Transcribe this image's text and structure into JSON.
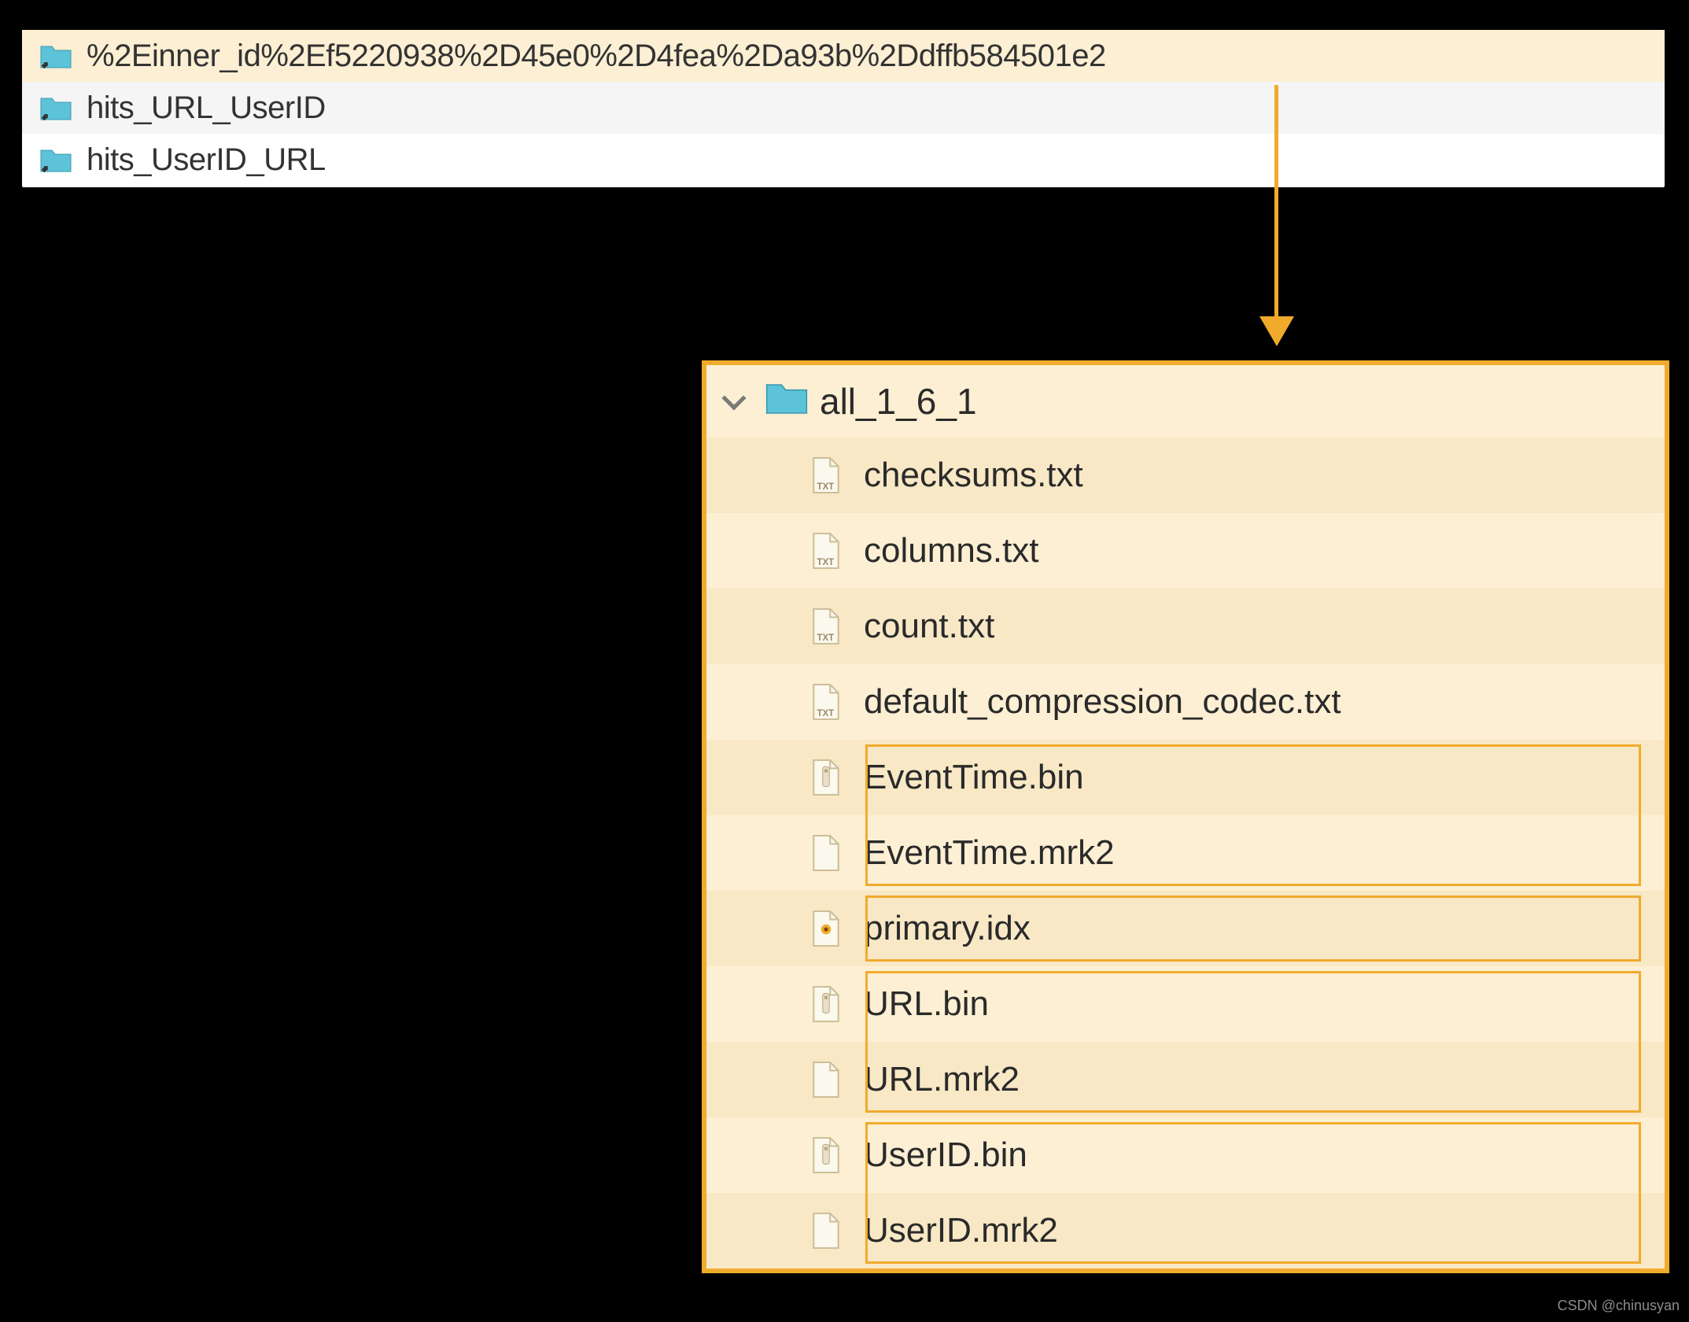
{
  "colors": {
    "accent": "#f1ab2c",
    "highlight_bg": "#fcefd3",
    "folder_fill": "#5cc3d9",
    "txt_label": "#9b8a6a",
    "bin_accent": "#f1ab2c"
  },
  "top_panel": {
    "rows": [
      {
        "icon": "folder-shortcut-icon",
        "label": "%2Einner_id%2Ef5220938%2D45e0%2D4fea%2Da93b%2Ddffb584501e2",
        "selected": true
      },
      {
        "icon": "folder-shortcut-icon",
        "label": "hits_URL_UserID",
        "selected": false
      },
      {
        "icon": "folder-shortcut-icon",
        "label": "hits_UserID_URL",
        "selected": false
      }
    ]
  },
  "bottom_panel": {
    "header": {
      "icon": "folder-icon",
      "label": "all_1_6_1",
      "expanded": true
    },
    "rows": [
      {
        "icon": "txt-file-icon",
        "label": "checksums.txt"
      },
      {
        "icon": "txt-file-icon",
        "label": "columns.txt"
      },
      {
        "icon": "txt-file-icon",
        "label": "count.txt"
      },
      {
        "icon": "txt-file-icon",
        "label": "default_compression_codec.txt"
      },
      {
        "icon": "bin-file-icon",
        "label": "EventTime.bin"
      },
      {
        "icon": "file-icon",
        "label": "EventTime.mrk2"
      },
      {
        "icon": "idx-file-icon",
        "label": "primary.idx"
      },
      {
        "icon": "bin-file-icon",
        "label": "URL.bin"
      },
      {
        "icon": "file-icon",
        "label": "URL.mrk2"
      },
      {
        "icon": "bin-file-icon",
        "label": "UserID.bin"
      },
      {
        "icon": "file-icon",
        "label": "UserID.mrk2"
      }
    ],
    "highlight_groups": [
      [
        4,
        5
      ],
      [
        6
      ],
      [
        7,
        8
      ],
      [
        9,
        10
      ]
    ]
  },
  "watermark": "CSDN @chinusyan"
}
